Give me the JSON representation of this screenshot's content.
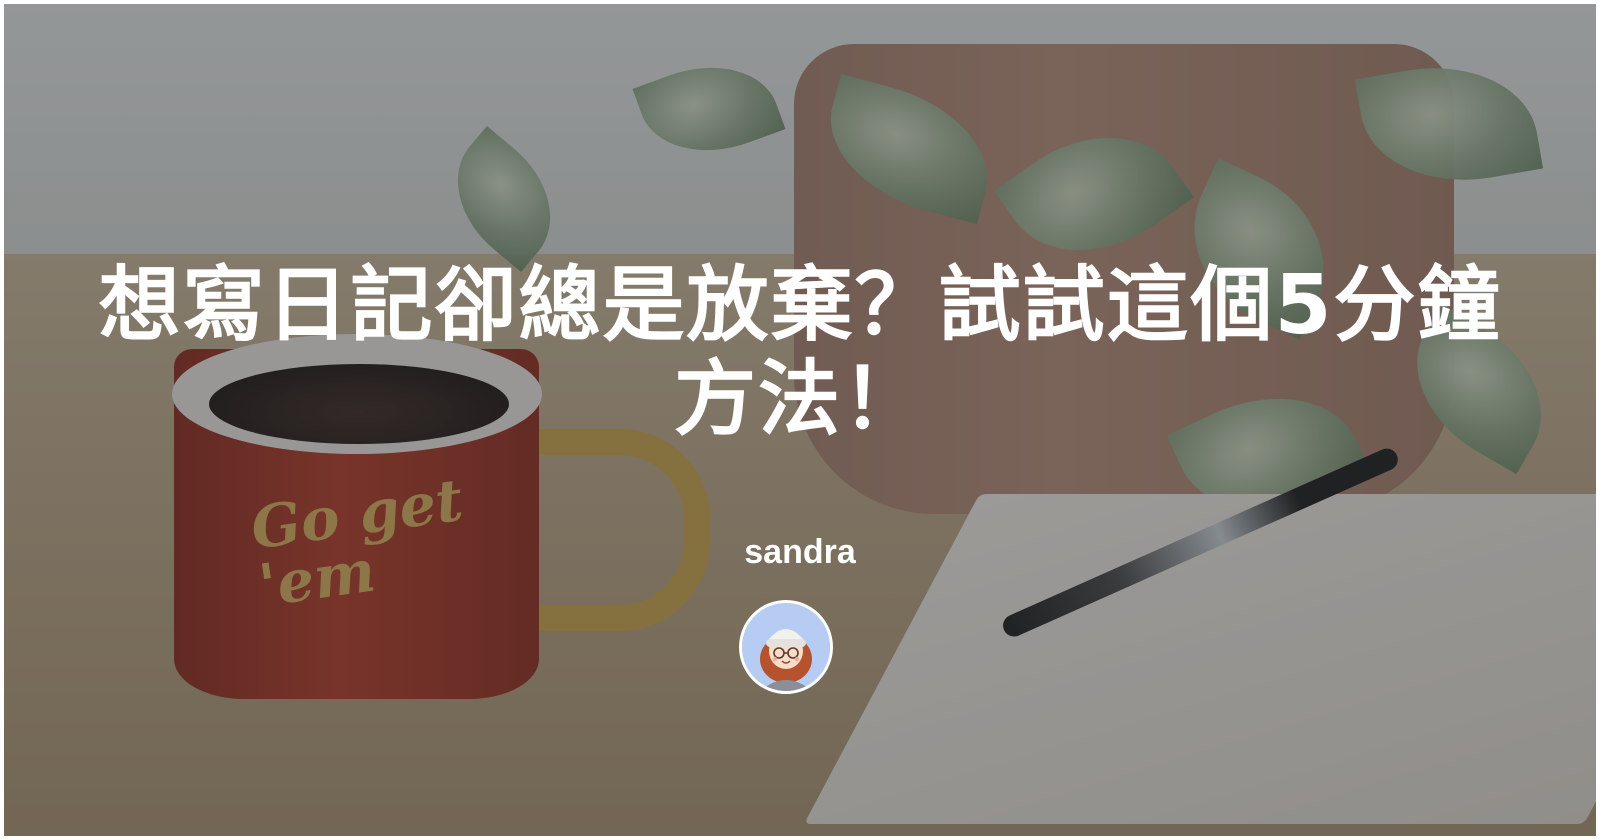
{
  "page": {
    "title": "想寫日記卻總是放棄？試試這個5分鐘方法！",
    "author": "sandra"
  },
  "background": {
    "mug_text": "Go get 'em"
  },
  "icons": {
    "avatar": "author-avatar-illustration"
  },
  "colors": {
    "overlay": "#282a30",
    "title_text": "#ffffff",
    "avatar_bg": "#b7ccf3"
  }
}
